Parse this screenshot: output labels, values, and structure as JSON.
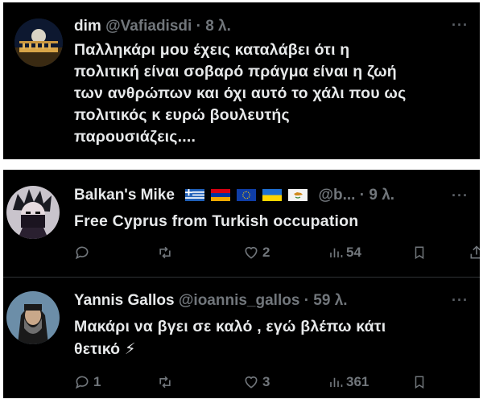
{
  "tweets": [
    {
      "name": "dim",
      "handle": "@Vafiadisdi",
      "dot": "·",
      "time": "8 λ.",
      "more": "···",
      "lines": [
        "Παλληκάρι μου έχεις καταλάβει ότι η",
        "πολιτική είναι σοβαρό πράγμα είναι η ζωή",
        "των ανθρώπων και όχι αυτό το χάλι που ως",
        "πολιτικός κ ευρώ βουλευτής",
        "παρουσιάζεις...."
      ]
    },
    {
      "name": "Balkan's Mike",
      "flags": [
        "greece",
        "armenia",
        "eu",
        "ukraine",
        "cyprus"
      ],
      "handle": "@b...",
      "dot": "·",
      "time": "9 λ.",
      "more": "···",
      "lines": [
        "Free Cyprus from Turkish occupation"
      ],
      "actions": {
        "replies": "",
        "reposts": "",
        "likes": "2",
        "views": "54"
      }
    },
    {
      "name": "Yannis Gallos",
      "handle": "@ioannis_gallos",
      "dot": "·",
      "time": "59 λ.",
      "more": "···",
      "lines": [
        "Μακάρι να βγει σε καλό , εγώ βλέπω κάτι",
        "θετικό ⚡"
      ],
      "actions": {
        "replies": "1",
        "reposts": "",
        "likes": "3",
        "views": "361"
      }
    }
  ],
  "colors": {
    "background": "#000000",
    "text": "#e7e9ea",
    "muted": "#71767b",
    "separator": "#2f3336"
  }
}
